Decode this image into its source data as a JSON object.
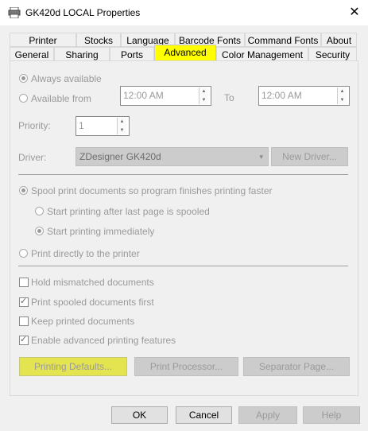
{
  "window": {
    "title": "GK420d LOCAL Properties",
    "close_glyph": "✕"
  },
  "tabs_top": [
    {
      "label": "Printer Settings"
    },
    {
      "label": "Stocks"
    },
    {
      "label": "Language"
    },
    {
      "label": "Barcode Fonts"
    },
    {
      "label": "Command Fonts"
    },
    {
      "label": "About"
    }
  ],
  "tabs_bottom": [
    {
      "label": "General"
    },
    {
      "label": "Sharing"
    },
    {
      "label": "Ports"
    },
    {
      "label": "Advanced"
    },
    {
      "label": "Color Management"
    },
    {
      "label": "Security"
    }
  ],
  "availability": {
    "always": "Always available",
    "from": "Available from",
    "from_time": "12:00 AM",
    "to_label": "To",
    "to_time": "12:00 AM"
  },
  "priority": {
    "label": "Priority:",
    "value": "1"
  },
  "driver": {
    "label": "Driver:",
    "value": "ZDesigner GK420d",
    "new_button": "New Driver..."
  },
  "spool": {
    "spool_option": "Spool print documents so program finishes printing faster",
    "after_last_page": "Start printing after last page is spooled",
    "immediately": "Start printing immediately",
    "direct": "Print directly to the printer"
  },
  "checkboxes": {
    "hold_mismatched": "Hold mismatched documents",
    "spooled_first": "Print spooled documents first",
    "keep_printed": "Keep printed documents",
    "advanced_features": "Enable advanced printing features"
  },
  "panel_buttons": {
    "printing_defaults": "Printing Defaults...",
    "print_processor": "Print Processor...",
    "separator_page": "Separator Page..."
  },
  "dialog_buttons": {
    "ok": "OK",
    "cancel": "Cancel",
    "apply": "Apply",
    "help": "Help"
  },
  "colors": {
    "highlight": "#ffff00",
    "disabled_text": "#9a9a9a"
  }
}
